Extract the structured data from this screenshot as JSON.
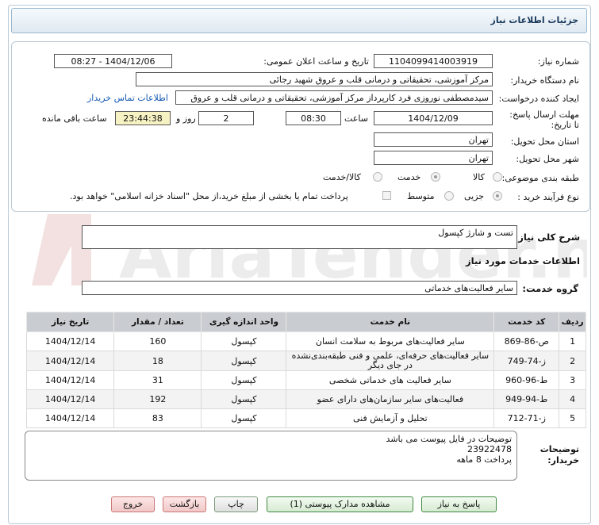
{
  "header": {
    "title": "جزئیات اطلاعات نیاز"
  },
  "form": {
    "need_number_label": "شماره نیاز:",
    "need_number": "1104099414003919",
    "announce_label": "تاریخ و ساعت اعلان عمومی:",
    "announce_value": "1404/12/06 - 08:27",
    "buyer_org_label": "نام دستگاه خریدار:",
    "buyer_org": "مرکز آموزشی، تحقیقاتی و درمانی قلب و عروق شهید رجائی",
    "creator_label": "ایجاد کننده درخواست:",
    "creator": "سیدمصطفی نوروزی فرد کارپرداز مرکز آموزشی، تحقیقاتی و درمانی قلب و عروق",
    "contact_link": "اطلاعات تماس خریدار",
    "deadline_label": "مهلت ارسال پاسخ: تا تاریخ:",
    "deadline_date": "1404/12/09",
    "time_label": "ساعت",
    "deadline_time": "08:30",
    "days_value": "2",
    "days_label": "روز و",
    "remaining_time": "23:44:38",
    "remaining_label": "ساعت باقی مانده",
    "province_label": "استان محل تحویل:",
    "province": "تهران",
    "city_label": "شهر محل تحویل:",
    "city": "تهران",
    "category_label": "طبقه بندی موضوعی:",
    "category_options": [
      "کالا",
      "خدمت",
      "کالا/خدمت"
    ],
    "category_selected": "خدمت",
    "purchase_type_label": "نوع فرآیند خرید :",
    "purchase_options": [
      "جزیی",
      "متوسط"
    ],
    "purchase_selected": "جزیی",
    "payment_note": "پرداخت تمام یا بخشی از مبلغ خرید،از محل \"اسناد خزانه اسلامی\" خواهد بود."
  },
  "summary": {
    "label": "شرح کلی نیاز:",
    "value": "تست و شارژ کپسول",
    "services_heading": "اطلاعات خدمات مورد نیاز",
    "group_label": "گروه خدمت:",
    "group_value": "سایر فعالیت‌های خدماتی"
  },
  "table": {
    "headers": [
      "ردیف",
      "کد خدمت",
      "نام خدمت",
      "واحد اندازه گیری",
      "تعداد / مقدار",
      "تاریخ نیاز"
    ],
    "rows": [
      [
        "1",
        "ص-86-869",
        "سایر فعالیت‌های مربوط به سلامت انسان",
        "کپسول",
        "160",
        "1404/12/14"
      ],
      [
        "2",
        "ز-74-749",
        "سایر فعالیت‌های حرفه‌ای، علمی و فنی طبقه‌بندی‌نشده در جای دیگر",
        "کپسول",
        "18",
        "1404/12/14"
      ],
      [
        "3",
        "ط-96-960",
        "سایر فعالیت های خدماتی شخصی",
        "کپسول",
        "31",
        "1404/12/14"
      ],
      [
        "4",
        "ط-94-949",
        "فعالیت‌های سایر سازمان‌های دارای عضو",
        "کپسول",
        "192",
        "1404/12/14"
      ],
      [
        "5",
        "ز-71-712",
        "تحلیل و آزمایش فنی",
        "کپسول",
        "83",
        "1404/12/14"
      ]
    ]
  },
  "buyer_notes": {
    "label": "توضیحات خریدار:",
    "lines": [
      "توضیحات در فایل پیوست می باشد",
      "23922478",
      "پرداخت 8 ماهه"
    ]
  },
  "buttons": {
    "reply": "پاسخ به نیاز",
    "attachments": "مشاهده مدارک پیوستی (1)",
    "print": "چاپ",
    "back": "بازگشت",
    "exit": "خروج"
  },
  "watermark": "AriaTender.net"
}
